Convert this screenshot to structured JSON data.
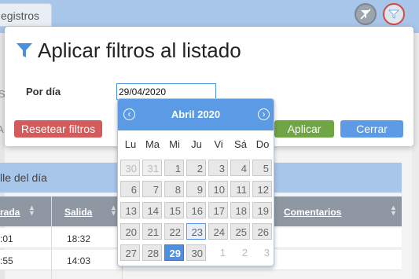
{
  "background": {
    "tab_label": "egistros",
    "panel_title": "lle del día",
    "columns": {
      "entrada": "rada",
      "salida": "Salida",
      "comentarios": "Comentarios"
    },
    "rows": [
      {
        "entrada": ":01",
        "salida": "18:32"
      },
      {
        "entrada": ":55",
        "salida": "14:03"
      }
    ],
    "partial_letters": {
      "s": "S",
      "a": "-A"
    }
  },
  "modal": {
    "title": "Aplicar filtros al listado",
    "field_label": "Por día",
    "date_value": "29/04/2020",
    "buttons": {
      "reset": "Resetear filtros",
      "apply": "Aplicar",
      "close": "Cerrar"
    }
  },
  "calendar": {
    "title": "Abril 2020",
    "prev": "‹",
    "next": "›",
    "weekdays": [
      "Lu",
      "Ma",
      "Mi",
      "Ju",
      "Vi",
      "Sá",
      "Do"
    ],
    "weeks": [
      [
        "30",
        "31",
        "1",
        "2",
        "3",
        "4",
        "5"
      ],
      [
        "6",
        "7",
        "8",
        "9",
        "10",
        "11",
        "12"
      ],
      [
        "13",
        "14",
        "15",
        "16",
        "17",
        "18",
        "19"
      ],
      [
        "20",
        "21",
        "22",
        "23",
        "24",
        "25",
        "26"
      ],
      [
        "27",
        "28",
        "29",
        "30",
        "1",
        "2",
        "3"
      ]
    ],
    "selected_day": "29",
    "today_day": "23"
  },
  "colors": {
    "accent": "#5b9be6",
    "danger": "#d45b5b",
    "success": "#6fa544"
  }
}
